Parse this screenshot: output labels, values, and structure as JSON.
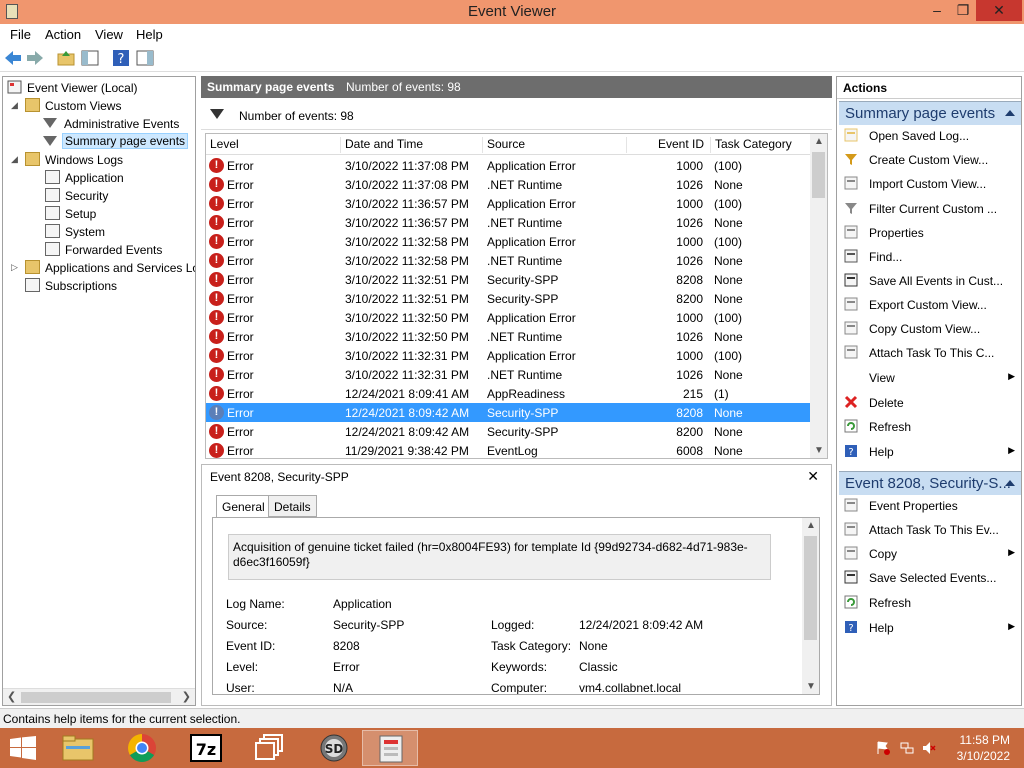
{
  "window": {
    "title": "Event Viewer",
    "min": "–",
    "max": "❐",
    "close": "✕"
  },
  "menu": [
    "File",
    "Action",
    "View",
    "Help"
  ],
  "tree": {
    "root": "Event Viewer (Local)",
    "custom_views": "Custom Views",
    "admin_events": "Administrative Events",
    "summary_events": "Summary page events",
    "windows_logs": "Windows Logs",
    "application": "Application",
    "security": "Security",
    "setup": "Setup",
    "system": "System",
    "forwarded": "Forwarded Events",
    "apps_services": "Applications and Services Lo",
    "subscriptions": "Subscriptions"
  },
  "center": {
    "title": "Summary page events",
    "count_header": "Number of events: 98",
    "filter_count": "Number of events: 98"
  },
  "grid": {
    "columns": [
      "Level",
      "Date and Time",
      "Source",
      "Event ID",
      "Task Category"
    ],
    "rows": [
      {
        "level": "Error",
        "date": "3/10/2022 11:37:08 PM",
        "source": "Application Error",
        "id": "1000",
        "task": "(100)"
      },
      {
        "level": "Error",
        "date": "3/10/2022 11:37:08 PM",
        "source": ".NET Runtime",
        "id": "1026",
        "task": "None"
      },
      {
        "level": "Error",
        "date": "3/10/2022 11:36:57 PM",
        "source": "Application Error",
        "id": "1000",
        "task": "(100)"
      },
      {
        "level": "Error",
        "date": "3/10/2022 11:36:57 PM",
        "source": ".NET Runtime",
        "id": "1026",
        "task": "None"
      },
      {
        "level": "Error",
        "date": "3/10/2022 11:32:58 PM",
        "source": "Application Error",
        "id": "1000",
        "task": "(100)"
      },
      {
        "level": "Error",
        "date": "3/10/2022 11:32:58 PM",
        "source": ".NET Runtime",
        "id": "1026",
        "task": "None"
      },
      {
        "level": "Error",
        "date": "3/10/2022 11:32:51 PM",
        "source": "Security-SPP",
        "id": "8208",
        "task": "None"
      },
      {
        "level": "Error",
        "date": "3/10/2022 11:32:51 PM",
        "source": "Security-SPP",
        "id": "8200",
        "task": "None"
      },
      {
        "level": "Error",
        "date": "3/10/2022 11:32:50 PM",
        "source": "Application Error",
        "id": "1000",
        "task": "(100)"
      },
      {
        "level": "Error",
        "date": "3/10/2022 11:32:50 PM",
        "source": ".NET Runtime",
        "id": "1026",
        "task": "None"
      },
      {
        "level": "Error",
        "date": "3/10/2022 11:32:31 PM",
        "source": "Application Error",
        "id": "1000",
        "task": "(100)"
      },
      {
        "level": "Error",
        "date": "3/10/2022 11:32:31 PM",
        "source": ".NET Runtime",
        "id": "1026",
        "task": "None"
      },
      {
        "level": "Error",
        "date": "12/24/2021 8:09:41 AM",
        "source": "AppReadiness",
        "id": "215",
        "task": "(1)"
      },
      {
        "level": "Error",
        "date": "12/24/2021 8:09:42 AM",
        "source": "Security-SPP",
        "id": "8208",
        "task": "None"
      },
      {
        "level": "Error",
        "date": "12/24/2021 8:09:42 AM",
        "source": "Security-SPP",
        "id": "8200",
        "task": "None"
      },
      {
        "level": "Error",
        "date": "11/29/2021 9:38:42 PM",
        "source": "EventLog",
        "id": "6008",
        "task": "None"
      }
    ]
  },
  "detail": {
    "title": "Event 8208, Security-SPP",
    "close": "✕",
    "tab_general": "General",
    "tab_details": "Details",
    "message": "Acquisition of genuine ticket failed (hr=0x8004FE93) for template Id {99d92734-d682-4d71-983e-d6ec3f16059f}",
    "labels": {
      "log_name": "Log Name:",
      "source": "Source:",
      "event_id": "Event ID:",
      "level": "Level:",
      "user": "User:",
      "logged": "Logged:",
      "task_category": "Task Category:",
      "keywords": "Keywords:",
      "computer": "Computer:"
    },
    "values": {
      "log_name": "Application",
      "source": "Security-SPP",
      "event_id": "8208",
      "level": "Error",
      "user": "N/A",
      "logged": "12/24/2021 8:09:42 AM",
      "task_category": "None",
      "keywords": "Classic",
      "computer": "vm4.collabnet.local"
    }
  },
  "actions": {
    "header": "Actions",
    "section1": "Summary page events",
    "items1": [
      "Open Saved Log...",
      "Create Custom View...",
      "Import Custom View...",
      "Filter Current Custom ...",
      "Properties",
      "Find...",
      "Save All Events in Cust...",
      "Export Custom View...",
      "Copy Custom View...",
      "Attach Task To This C...",
      "View",
      "Delete",
      "Refresh",
      "Help"
    ],
    "section2": "Event 8208, Security-S...",
    "items2": [
      "Event Properties",
      "Attach Task To This Ev...",
      "Copy",
      "Save Selected Events...",
      "Refresh",
      "Help"
    ]
  },
  "status": "Contains help items for the current selection.",
  "taskbar": {
    "time": "11:58 PM",
    "date": "3/10/2022"
  },
  "colors": {
    "titlebar": "#f0966e",
    "taskbar": "#c76a3e",
    "selection": "#3399ff",
    "section": "#c8ddf2"
  }
}
